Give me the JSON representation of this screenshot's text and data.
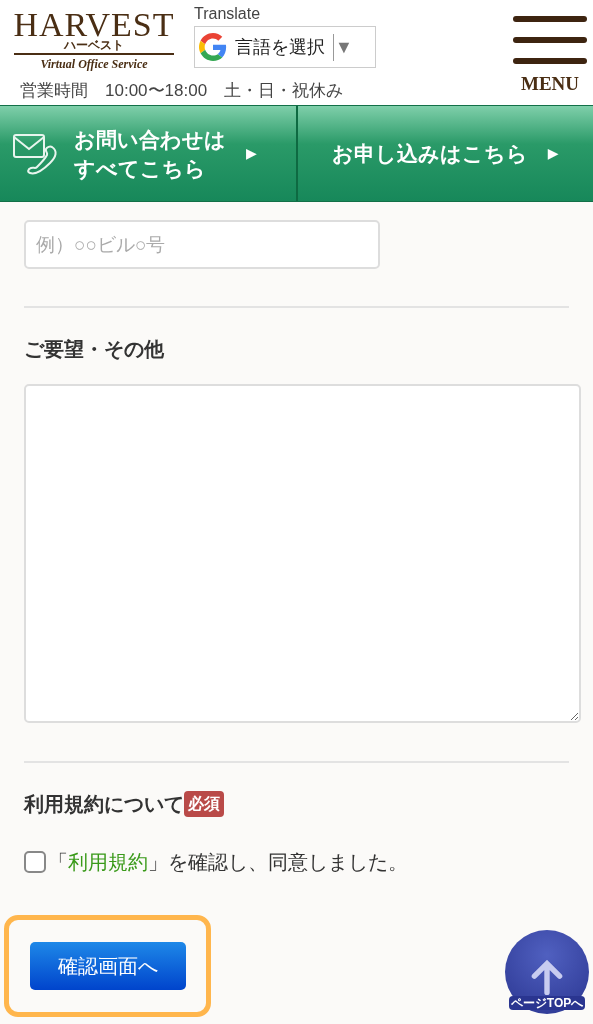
{
  "header": {
    "logo": {
      "main": "HARVEST",
      "kana": "ハーベスト",
      "tagline": "Virtual Office Service"
    },
    "translate": {
      "label": "Translate",
      "select": "言語を選択",
      "caret": "▼"
    },
    "hours": "営業時間　10:00〜18:00　土・日・祝休み",
    "menu": "MENU"
  },
  "nav": [
    {
      "kind": "contact",
      "lines": [
        "お問い合わせは",
        "すべてこちら"
      ],
      "arrow": "▶"
    },
    {
      "kind": "apply",
      "lines": [
        "お申し込みはこちら"
      ],
      "arrow": "▶"
    }
  ],
  "form": {
    "address_field": {
      "placeholder": "例）○○ビル○号"
    },
    "requests": {
      "label": "ご要望・その他"
    },
    "terms": {
      "label": "利用規約について",
      "badge": "必須",
      "consent": {
        "prefix": "「",
        "link": "利用規約",
        "suffix": "」を確認し、同意しました。",
        "checked": false
      }
    },
    "submit": {
      "label": "確認画面へ",
      "highlighted": true
    }
  },
  "page_top": {
    "label": "ページTOPへ"
  }
}
